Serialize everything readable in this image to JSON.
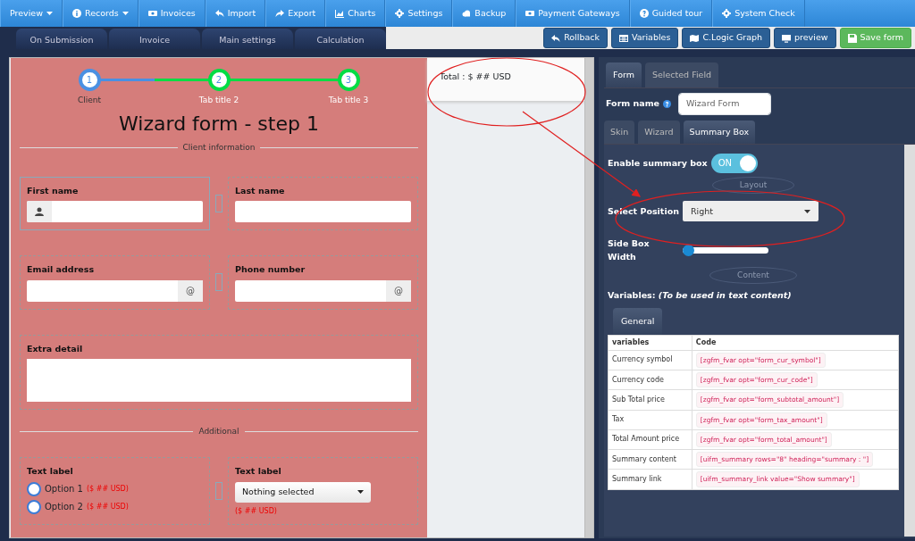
{
  "menu": [
    {
      "label": "Preview",
      "caret": true
    },
    {
      "label": "Records",
      "caret": true
    },
    {
      "label": "Invoices",
      "caret": false
    },
    {
      "label": "Import",
      "caret": false
    },
    {
      "label": "Export",
      "caret": false
    },
    {
      "label": "Charts",
      "caret": false
    },
    {
      "label": "Settings",
      "caret": false
    },
    {
      "label": "Backup",
      "caret": false
    },
    {
      "label": "Payment Gateways",
      "caret": false
    },
    {
      "label": "Guided tour",
      "caret": false
    },
    {
      "label": "System Check",
      "caret": false
    }
  ],
  "builder_tabs": [
    "On Submission",
    "Invoice",
    "Main settings",
    "Calculation"
  ],
  "action_buttons": [
    {
      "label": "Rollback",
      "kind": "primary"
    },
    {
      "label": "Variables",
      "kind": "primary"
    },
    {
      "label": "C.Logic Graph",
      "kind": "primary"
    },
    {
      "label": "preview",
      "kind": "primary"
    },
    {
      "label": "Save form",
      "kind": "success"
    }
  ],
  "wizard": {
    "steps": [
      {
        "number": "1",
        "label": "Client",
        "selected": true
      },
      {
        "number": "2",
        "label": "Tab title 2",
        "selected": false
      },
      {
        "number": "3",
        "label": "Tab title 3",
        "selected": false
      }
    ],
    "title": "Wizard form - step 1"
  },
  "form_rows": [
    {
      "kind": "divider",
      "label": "Client information"
    },
    {
      "kind": "pair",
      "cells": [
        {
          "kind": "text",
          "label": "First name",
          "prepend_icon": true,
          "selected": true
        },
        {
          "kind": "text",
          "label": "Last name",
          "selected": false
        }
      ]
    },
    {
      "kind": "pair",
      "cells": [
        {
          "kind": "text",
          "label": "Email address",
          "addon_text": "@",
          "selected": false
        },
        {
          "kind": "text",
          "label": "Phone number",
          "addon_text": "@",
          "selected": false
        }
      ]
    },
    {
      "kind": "textarea",
      "label": "Extra detail"
    },
    {
      "kind": "divider",
      "label": "Additional"
    },
    {
      "kind": "pair",
      "cells": [
        {
          "kind": "radio",
          "label": "Text label",
          "selected": false,
          "options": [
            {
              "label": "Option 1",
              "price": "($ ## USD)",
              "checked": false
            },
            {
              "label": "Option 2",
              "price": "($ ## USD)",
              "checked": false
            }
          ]
        },
        {
          "kind": "select",
          "label": "Text label",
          "value": "Nothing selected",
          "price": "($ ## USD)",
          "selected": false
        }
      ]
    }
  ],
  "summary_box": {
    "text": "Total : $ ## USD"
  },
  "side_panel": {
    "tabs": [
      {
        "label": "Form",
        "selected": true
      },
      {
        "label": "Selected Field",
        "selected": false
      }
    ],
    "form_name": {
      "label": "Form name",
      "value": "Wizard Form"
    },
    "subtabs": [
      {
        "label": "Skin",
        "selected": false
      },
      {
        "label": "Wizard",
        "selected": false
      },
      {
        "label": "Summary Box",
        "selected": true
      }
    ],
    "enable_summary": {
      "label": "Enable summary box",
      "on": true,
      "text": "ON"
    },
    "layout_heading": "Layout",
    "position": {
      "label": "Select Position",
      "value": "Right"
    },
    "side_box_width": {
      "label": "Side Box Width",
      "level": 0
    },
    "content_heading": "Content",
    "variables_note": "Variables: *(To be used in text content)*",
    "variable_tabs": [
      {
        "label": "General",
        "selected": true
      }
    ],
    "table": {
      "columns": [
        "variables",
        "Code"
      ],
      "rows": [
        [
          "Currency symbol",
          "[zgfm_fvar opt=\"form_cur_symbol\"]"
        ],
        [
          "Currency code",
          "[zgfm_fvar opt=\"form_cur_code\"]"
        ],
        [
          "Sub Total price",
          "[zgfm_fvar opt=\"form_subtotal_amount\"]"
        ],
        [
          "Tax",
          "[zgfm_fvar opt=\"form_tax_amount\"]"
        ],
        [
          "Total Amount price",
          "[zgfm_fvar opt=\"form_total_amount\"]"
        ],
        [
          "Summary content",
          "[uifm_summary rows=\"8\" heading=\"summary : \"]"
        ],
        [
          "Summary link",
          "[uifm_summary_link value=\"Show summary\"]"
        ]
      ]
    }
  }
}
